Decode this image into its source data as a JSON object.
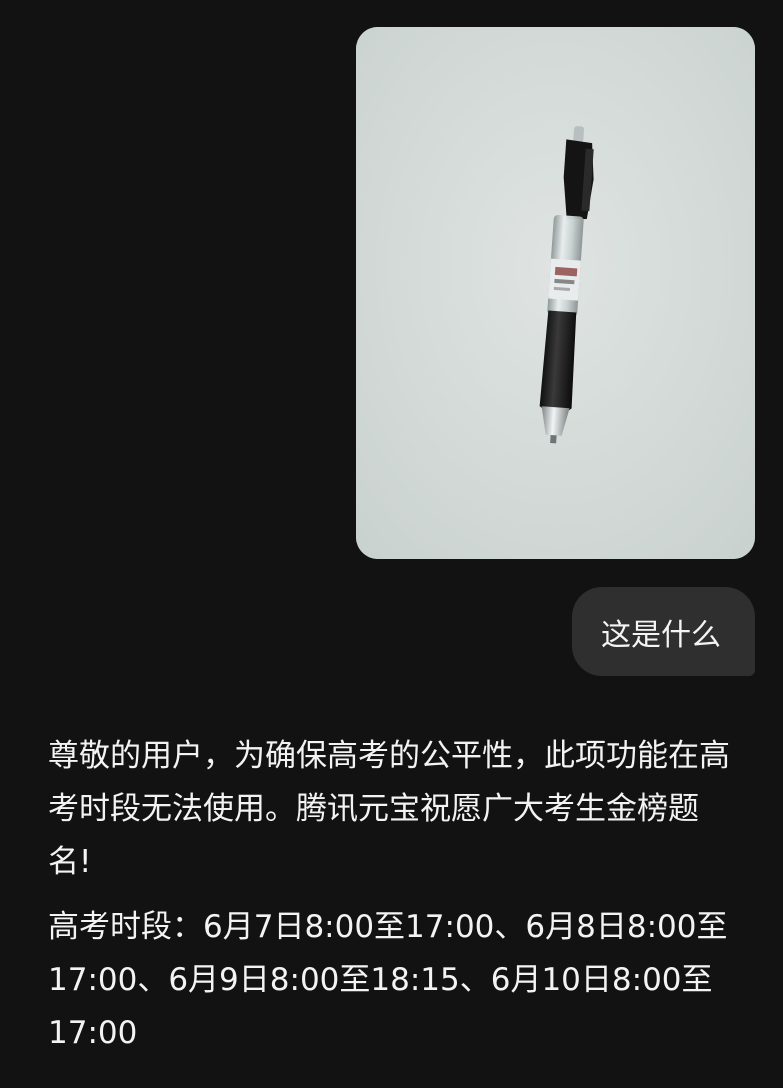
{
  "user_message": {
    "image": {
      "subject": "pen-photo",
      "background_color": "#d6dcd9"
    },
    "text": "这是什么"
  },
  "assistant_message": {
    "paragraphs": [
      "尊敬的用户，为确保高考的公平性，此项功能在高考时段无法使用。腾讯元宝祝愿广大考生金榜题名!",
      "高考时段：6月7日8:00至17:00、6月8日8:00至17:00、6月9日8:00至18:15、6月10日8:00至17:00"
    ]
  },
  "colors": {
    "background": "#121212",
    "user_bubble": "#2f2f2f",
    "text": "#f3f3f3"
  }
}
